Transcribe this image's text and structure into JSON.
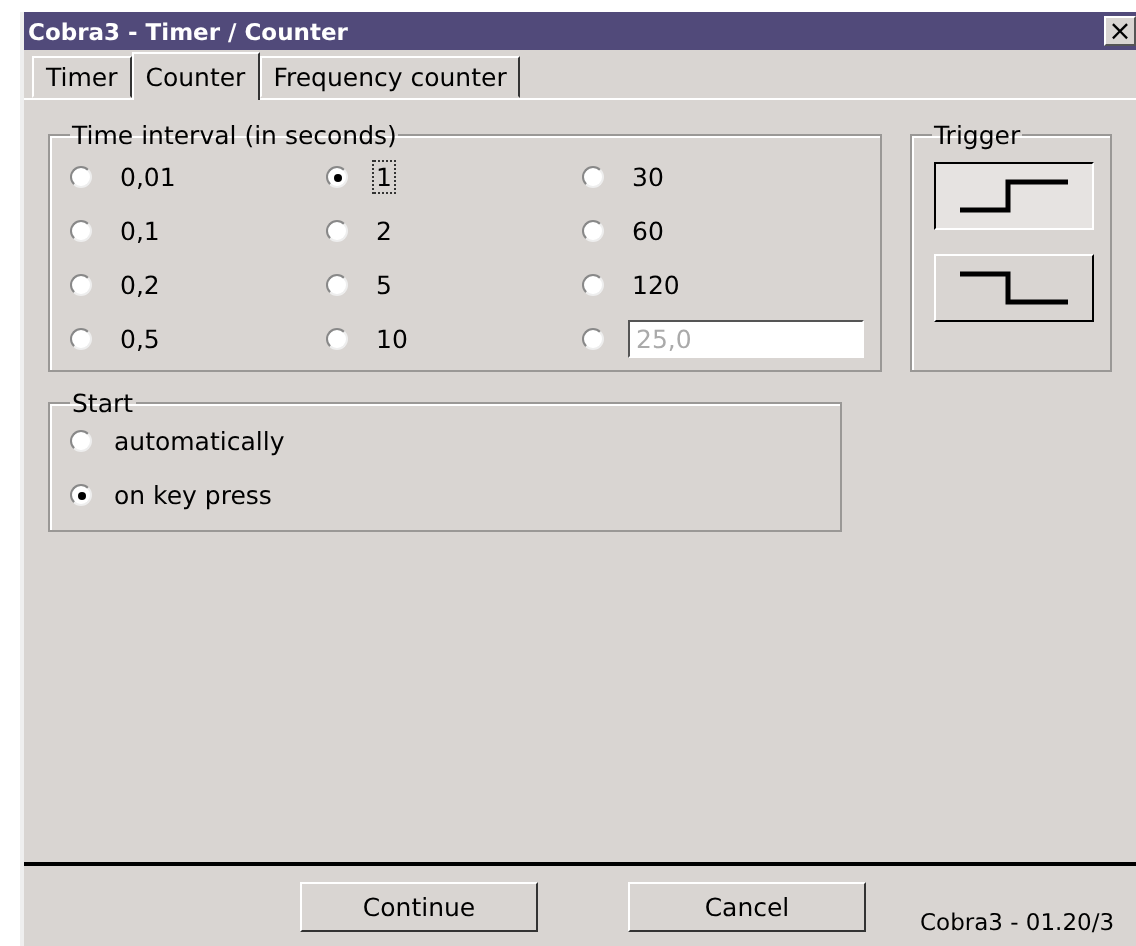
{
  "window": {
    "title": "Cobra3 - Timer / Counter",
    "close": "×"
  },
  "tabs": [
    {
      "label": "Timer",
      "selected": false
    },
    {
      "label": "Counter",
      "selected": true
    },
    {
      "label": "Frequency counter",
      "selected": false
    }
  ],
  "interval": {
    "title": "Time interval (in seconds)",
    "options": [
      {
        "kind": "value",
        "label": "0,01",
        "selected": false
      },
      {
        "kind": "value",
        "label": "1",
        "selected": true
      },
      {
        "kind": "value",
        "label": "30",
        "selected": false
      },
      {
        "kind": "value",
        "label": "0,1",
        "selected": false
      },
      {
        "kind": "value",
        "label": "2",
        "selected": false
      },
      {
        "kind": "value",
        "label": "60",
        "selected": false
      },
      {
        "kind": "value",
        "label": "0,2",
        "selected": false
      },
      {
        "kind": "value",
        "label": "5",
        "selected": false
      },
      {
        "kind": "value",
        "label": "120",
        "selected": false
      },
      {
        "kind": "value",
        "label": "0,5",
        "selected": false
      },
      {
        "kind": "value",
        "label": "10",
        "selected": false
      },
      {
        "kind": "custom",
        "value": "25,0",
        "disabled": true,
        "selected": false
      }
    ]
  },
  "trigger": {
    "title": "Trigger",
    "options": [
      {
        "kind": "rising",
        "selected": true
      },
      {
        "kind": "falling",
        "selected": false
      }
    ]
  },
  "start": {
    "title": "Start",
    "options": [
      {
        "label": "automatically",
        "selected": false
      },
      {
        "label": "on key press",
        "selected": true
      }
    ]
  },
  "buttons": [
    "Continue",
    "Cancel"
  ],
  "version": "Cobra3 - 01.20/3"
}
